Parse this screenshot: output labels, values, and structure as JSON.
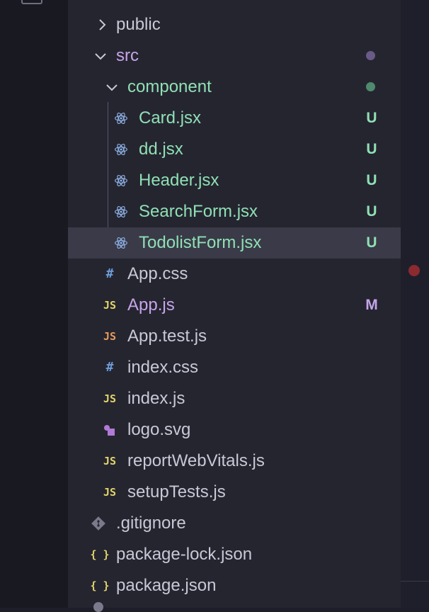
{
  "colors": {
    "folder": "#c6a5ea",
    "untracked": "#8fe0b4",
    "modified": "#c6a5ea",
    "default": "#c8c8d6",
    "react": "#8fb3e8",
    "js_yellow": "#e0d46a",
    "js_orange": "#e79a5a",
    "css_blue": "#6e9cd8",
    "json_yellow": "#e0d46a",
    "svg_purple": "#b07ad6",
    "git_gray": "#7a7a8c"
  },
  "explorer": {
    "items": [
      {
        "label": "public",
        "type": "folder",
        "expanded": false,
        "icon": "chevron-right-icon"
      },
      {
        "label": "src",
        "type": "folder",
        "expanded": true,
        "icon": "chevron-down-icon",
        "status": "dot"
      },
      {
        "label": "component",
        "type": "folder",
        "expanded": true,
        "icon": "chevron-down-icon",
        "status": "dot"
      },
      {
        "label": "Card.jsx",
        "type": "file",
        "icon": "react-icon",
        "badge": "U"
      },
      {
        "label": "dd.jsx",
        "type": "file",
        "icon": "react-icon",
        "badge": "U"
      },
      {
        "label": "Header.jsx",
        "type": "file",
        "icon": "react-icon",
        "badge": "U"
      },
      {
        "label": "SearchForm.jsx",
        "type": "file",
        "icon": "react-icon",
        "badge": "U"
      },
      {
        "label": "TodolistForm.jsx",
        "type": "file",
        "icon": "react-icon",
        "badge": "U",
        "selected": true
      },
      {
        "label": "App.css",
        "type": "file",
        "icon": "css-hash-icon",
        "glyph": "#"
      },
      {
        "label": "App.js",
        "type": "file",
        "icon": "js-icon",
        "glyph": "JS",
        "badge": "M"
      },
      {
        "label": "App.test.js",
        "type": "file",
        "icon": "js-test-icon",
        "glyph": "JS"
      },
      {
        "label": "index.css",
        "type": "file",
        "icon": "css-hash-icon",
        "glyph": "#"
      },
      {
        "label": "index.js",
        "type": "file",
        "icon": "js-icon",
        "glyph": "JS"
      },
      {
        "label": "logo.svg",
        "type": "file",
        "icon": "svg-image-icon"
      },
      {
        "label": "reportWebVitals.js",
        "type": "file",
        "icon": "js-icon",
        "glyph": "JS"
      },
      {
        "label": "setupTests.js",
        "type": "file",
        "icon": "js-icon",
        "glyph": "JS"
      },
      {
        "label": ".gitignore",
        "type": "file",
        "icon": "git-icon"
      },
      {
        "label": "package-lock.json",
        "type": "file",
        "icon": "json-braces-icon",
        "glyph": "{ }"
      },
      {
        "label": "package.json",
        "type": "file",
        "icon": "json-braces-icon",
        "glyph": "{ }"
      }
    ]
  }
}
